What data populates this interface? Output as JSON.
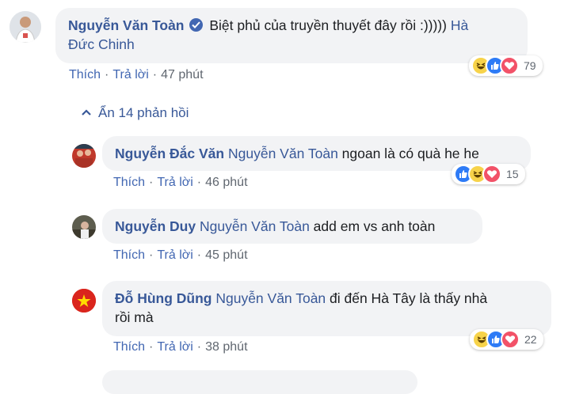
{
  "comments": [
    {
      "author": "Nguyễn Văn Toàn",
      "text_line1": "Biệt phủ của truyền thuyết đây rồi :))))) ",
      "mention_part1": "Hà",
      "mention_part2": "Đức Chinh",
      "like_label": "Thích",
      "reply_label": "Trả lời",
      "time": "47 phút",
      "reaction_icons": [
        "haha",
        "like",
        "love"
      ],
      "reaction_count": "79"
    },
    {
      "author": "Nguyễn Đắc Văn",
      "mention": "Nguyễn Văn Toàn",
      "text": " ngoan là có quà he he",
      "like_label": "Thích",
      "reply_label": "Trả lời",
      "time": "46 phút",
      "reaction_icons": [
        "like",
        "haha",
        "love"
      ],
      "reaction_count": "15"
    },
    {
      "author": "Nguyễn Duy",
      "mention": "Nguyễn Văn Toàn",
      "text": " add em vs anh toàn",
      "like_label": "Thích",
      "reply_label": "Trả lời",
      "time": "45 phút"
    },
    {
      "author": "Đỗ Hùng Dũng",
      "mention": "Nguyễn Văn Toàn",
      "text_line1": " đi đến Hà Tây là thấy nhà",
      "text_line2": "rồi mà",
      "like_label": "Thích",
      "reply_label": "Trả lời",
      "time": "38 phút",
      "reaction_icons": [
        "haha",
        "like",
        "love"
      ],
      "reaction_count": "22"
    }
  ],
  "replies_toggle": "Ẩn 14 phản hồi",
  "colors": {
    "link": "#385898",
    "action": "#4267b2",
    "bubble": "#f2f3f5",
    "like": "#2e7bf6",
    "love": "#f25268",
    "haha": "#f7d34a"
  }
}
